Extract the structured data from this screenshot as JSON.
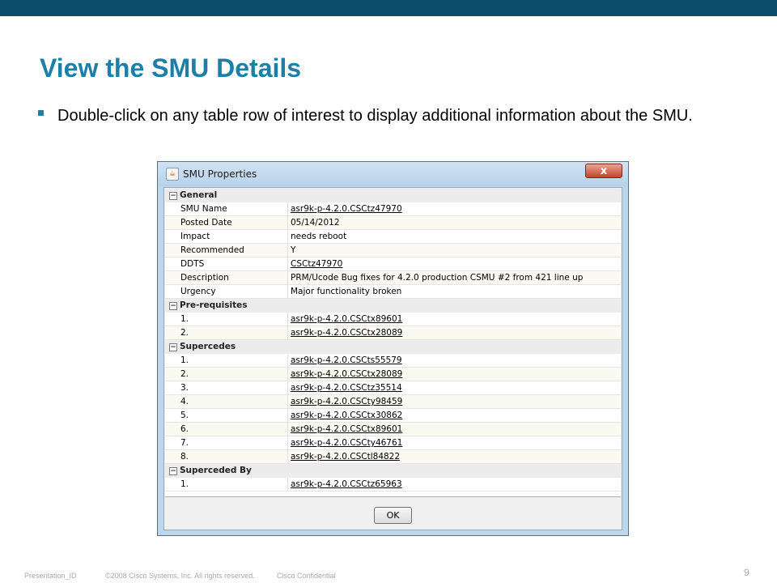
{
  "slide": {
    "title": "View the SMU Details",
    "bullet": "Double-click on any table row of interest to display additional information about the SMU."
  },
  "dialog": {
    "title": "SMU Properties",
    "close_label": "x",
    "ok_label": "OK",
    "sections": [
      {
        "label": "General",
        "rows": [
          {
            "key": "SMU Name",
            "value": "asr9k-p-4.2.0.CSCtz47970",
            "link": true
          },
          {
            "key": "Posted Date",
            "value": "05/14/2012",
            "link": false
          },
          {
            "key": "Impact",
            "value": "needs reboot",
            "link": false
          },
          {
            "key": "Recommended",
            "value": "Y",
            "link": false
          },
          {
            "key": "DDTS",
            "value": "CSCtz47970",
            "link": true
          },
          {
            "key": "Description",
            "value": "PRM/Ucode Bug fixes for 4.2.0 production CSMU #2 from 421 line up",
            "link": false
          },
          {
            "key": "Urgency",
            "value": "Major functionality broken",
            "link": false
          }
        ]
      },
      {
        "label": "Pre-requisites",
        "rows": [
          {
            "key": "1.",
            "value": "asr9k-p-4.2.0.CSCtx89601",
            "link": true
          },
          {
            "key": "2.",
            "value": "asr9k-p-4.2.0.CSCtx28089",
            "link": true
          }
        ]
      },
      {
        "label": "Supercedes",
        "rows": [
          {
            "key": "1.",
            "value": "asr9k-p-4.2.0.CSCts55579",
            "link": true
          },
          {
            "key": "2.",
            "value": "asr9k-p-4.2.0.CSCtx28089",
            "link": true
          },
          {
            "key": "3.",
            "value": "asr9k-p-4.2.0.CSCtz35514",
            "link": true
          },
          {
            "key": "4.",
            "value": "asr9k-p-4.2.0.CSCty98459",
            "link": true
          },
          {
            "key": "5.",
            "value": "asr9k-p-4.2.0.CSCtx30862",
            "link": true
          },
          {
            "key": "6.",
            "value": "asr9k-p-4.2.0.CSCtx89601",
            "link": true
          },
          {
            "key": "7.",
            "value": "asr9k-p-4.2.0.CSCty46761",
            "link": true
          },
          {
            "key": "8.",
            "value": "asr9k-p-4.2.0.CSCtl84822",
            "link": true
          }
        ]
      },
      {
        "label": "Superceded By",
        "rows": [
          {
            "key": "1.",
            "value": "asr9k-p-4.2.0.CSCtz65963",
            "link": true
          }
        ]
      }
    ]
  },
  "footer": {
    "presentation_id": "Presentation_ID",
    "copyright": "©2008 Cisco Systems, Inc. All rights reserved.",
    "confidential": "Cisco Confidential",
    "page_number": "9"
  },
  "colors": {
    "top_bar": "#0b4d6b",
    "title_blue": "#1c7fa7",
    "bullet_blue": "#1c7fa7"
  }
}
